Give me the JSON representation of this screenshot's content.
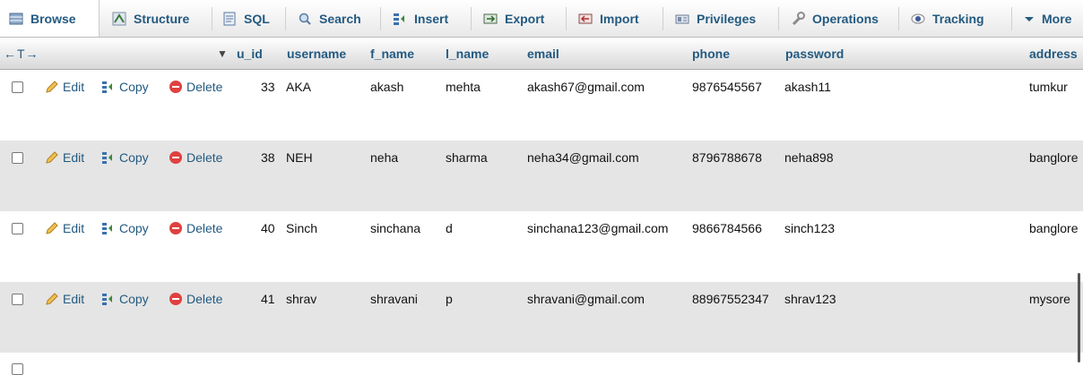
{
  "tabs": [
    {
      "label": "Browse",
      "icon": "browse-icon"
    },
    {
      "label": "Structure",
      "icon": "structure-icon"
    },
    {
      "label": "SQL",
      "icon": "sql-icon"
    },
    {
      "label": "Search",
      "icon": "search-icon"
    },
    {
      "label": "Insert",
      "icon": "insert-icon"
    },
    {
      "label": "Export",
      "icon": "export-icon"
    },
    {
      "label": "Import",
      "icon": "import-icon"
    },
    {
      "label": "Privileges",
      "icon": "privileges-icon"
    },
    {
      "label": "Operations",
      "icon": "wrench-icon"
    },
    {
      "label": "Tracking",
      "icon": "eye-icon"
    },
    {
      "label": "More",
      "icon": "triangle-down-icon"
    }
  ],
  "header": {
    "arrows": "←T→",
    "sort_arrow": "▼",
    "columns": [
      "u_id",
      "username",
      "f_name",
      "l_name",
      "email",
      "phone",
      "password",
      "address"
    ]
  },
  "actions": {
    "edit": "Edit",
    "copy": "Copy",
    "delete": "Delete"
  },
  "rows": [
    {
      "u_id": "33",
      "username": "AKA",
      "f_name": "akash",
      "l_name": "mehta",
      "email": "akash67@gmail.com",
      "phone": "9876545567",
      "password": "akash11",
      "address": "tumkur"
    },
    {
      "u_id": "38",
      "username": "NEH",
      "f_name": "neha",
      "l_name": "sharma",
      "email": "neha34@gmail.com",
      "phone": "8796788678",
      "password": "neha898",
      "address": "banglore"
    },
    {
      "u_id": "40",
      "username": "Sinch",
      "f_name": "sinchana",
      "l_name": "d",
      "email": "sinchana123@gmail.com",
      "phone": "9866784566",
      "password": "sinch123",
      "address": "banglore"
    },
    {
      "u_id": "41",
      "username": "shrav",
      "f_name": "shravani",
      "l_name": "p",
      "email": "shravani@gmail.com",
      "phone": "88967552347",
      "password": "shrav123",
      "address": "mysore"
    }
  ],
  "colors": {
    "link": "#235a81",
    "row_alt": "#e5e5e5",
    "delete_red": "#e04040",
    "edit_pencil": "#e0a030"
  }
}
